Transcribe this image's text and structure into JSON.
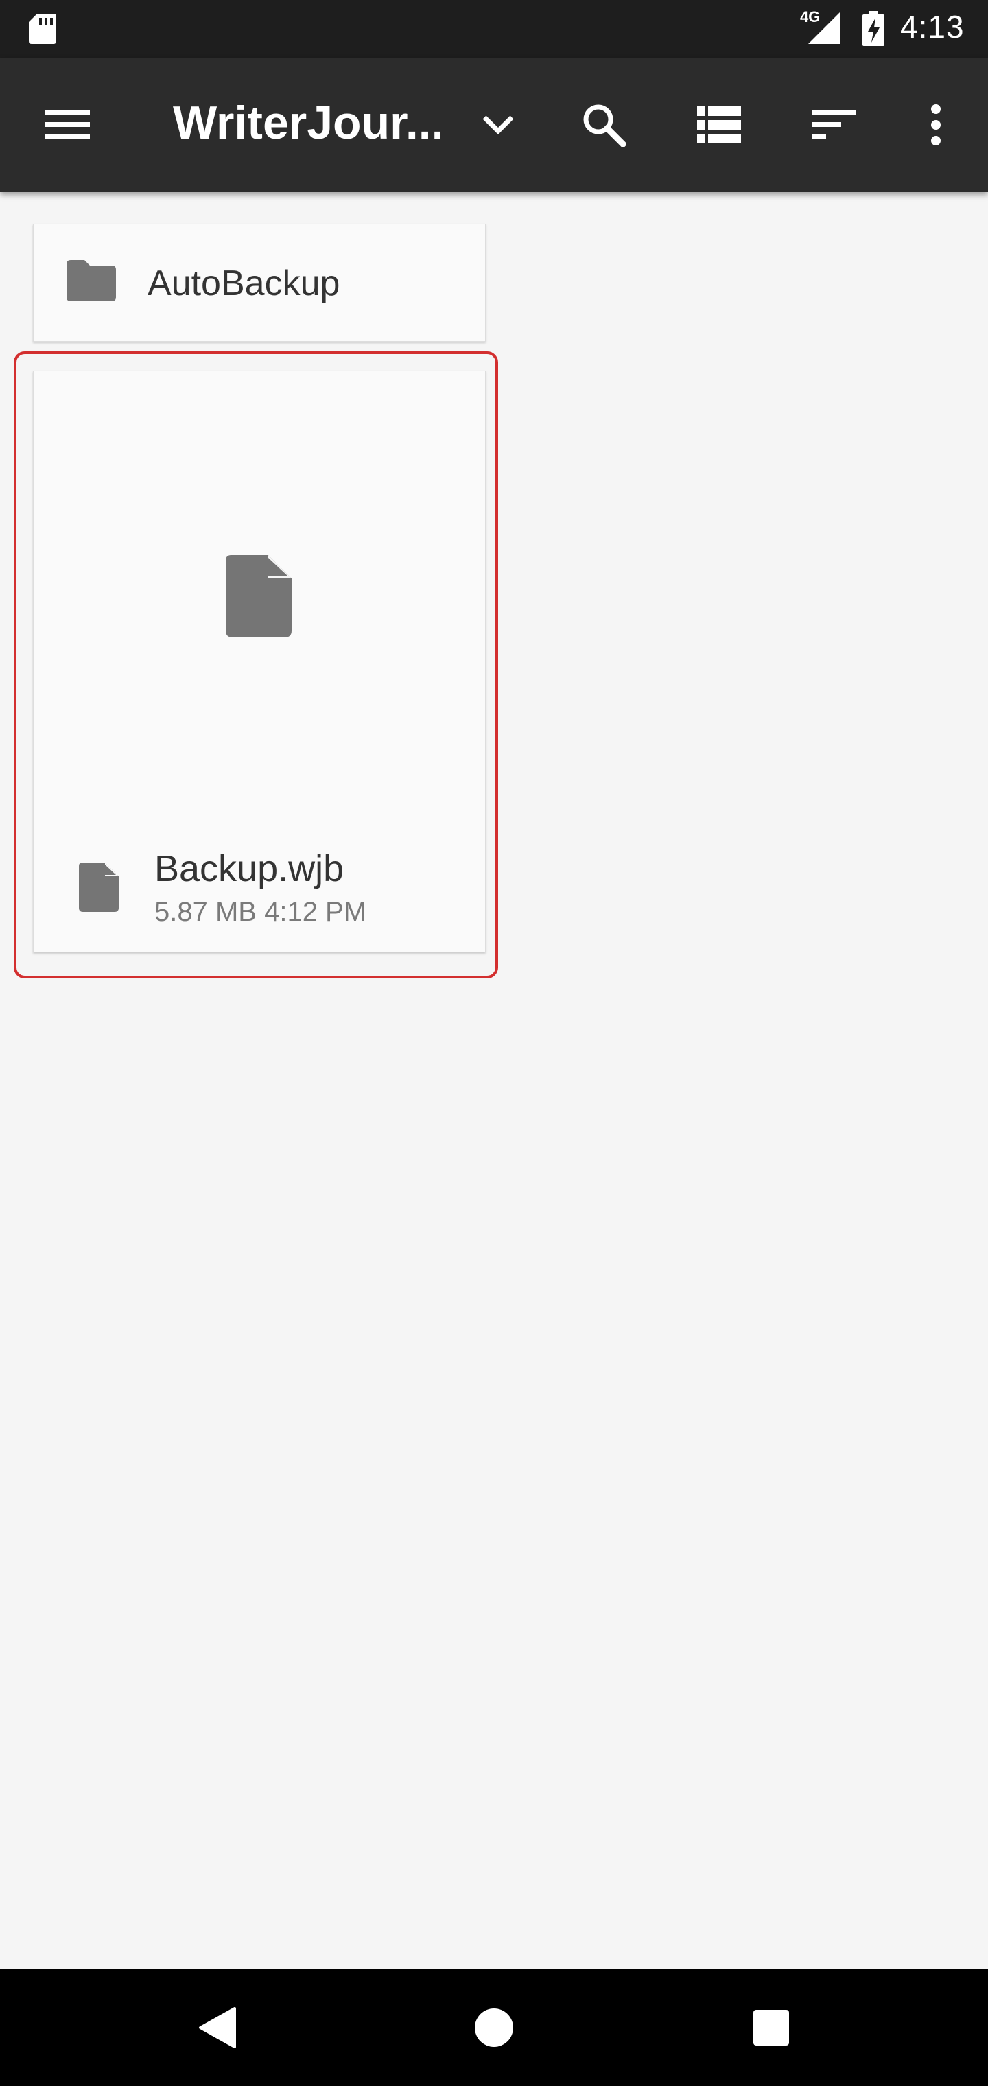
{
  "status_bar": {
    "time": "4:13",
    "network": "4G",
    "icons": [
      "sd-card-icon",
      "signal-icon",
      "battery-charging-icon"
    ]
  },
  "toolbar": {
    "title": "WriterJour...",
    "icons": [
      "menu-icon",
      "chevron-down-icon",
      "search-icon",
      "list-view-icon",
      "sort-icon",
      "more-vert-icon"
    ]
  },
  "items": {
    "folder": {
      "name": "AutoBackup",
      "icon": "folder-icon"
    },
    "file": {
      "name": "Backup.wjb",
      "size": "5.87 MB",
      "time": "4:12 PM",
      "icon": "file-icon",
      "selected": true
    }
  },
  "nav_bar": {
    "icons": [
      "back-icon",
      "home-icon",
      "recents-icon"
    ]
  },
  "colors": {
    "status_bar_bg": "#1e1e1e",
    "toolbar_bg": "#2c2c2c",
    "page_bg": "#f5f5f5",
    "card_bg": "#fafafa",
    "icon_gray": "#757575",
    "selection": "#d32f2f"
  }
}
